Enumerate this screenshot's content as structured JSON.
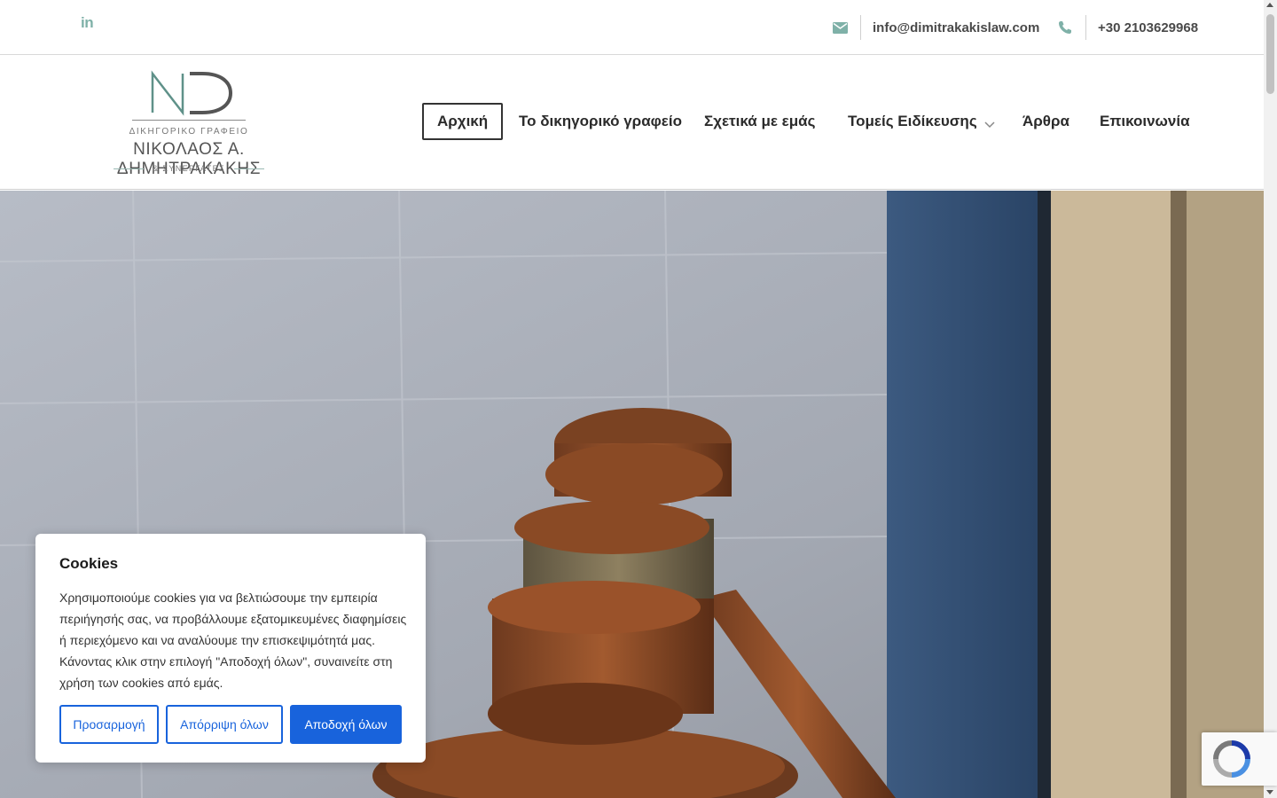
{
  "topbar": {
    "linkedin_icon": "linkedin-icon",
    "email": "info@dimitrakakislaw.com",
    "phone": "+30 2103629968",
    "icon_color": "#7fb1a8"
  },
  "logo": {
    "monogram": "ND",
    "subtitle": "ΔΙΚΗΓΟΡΙΚΟ ΓΡΑΦΕΙΟ",
    "name": "ΝΙΚΟΛΑΟΣ Α. ΔΗΜΗΤΡΑΚΑΚΗΣ",
    "tagline": "& ΣΥΝΕΡΓΑΤΕΣ",
    "accent": "#5f9189"
  },
  "nav": {
    "items": [
      {
        "label": "Αρχική",
        "active": true
      },
      {
        "label": "Το δικηγορικό γραφείο"
      },
      {
        "label": "Σχετικά με εμάς"
      },
      {
        "label": "Τομείς Ειδίκευσης",
        "dropdown": true
      },
      {
        "label": "Άρθρα"
      },
      {
        "label": "Επικοινωνία"
      }
    ]
  },
  "cookie": {
    "title": "Cookies",
    "text": "Χρησιμοποιούμε cookies για να βελτιώσουμε την εμπειρία περιήγησής σας, να προβάλλουμε εξατομικευμένες διαφημίσεις ή περιεχόμενο και να αναλύουμε την επισκεψιμότητά μας. Κάνοντας κλικ στην επιλογή \"Αποδοχή όλων\", συναινείτε στη χρήση των cookies από εμάς.",
    "customize": "Προσαρμογή",
    "reject": "Απόρριψη όλων",
    "accept": "Αποδοχή όλων",
    "button_color": "#1863dc"
  }
}
